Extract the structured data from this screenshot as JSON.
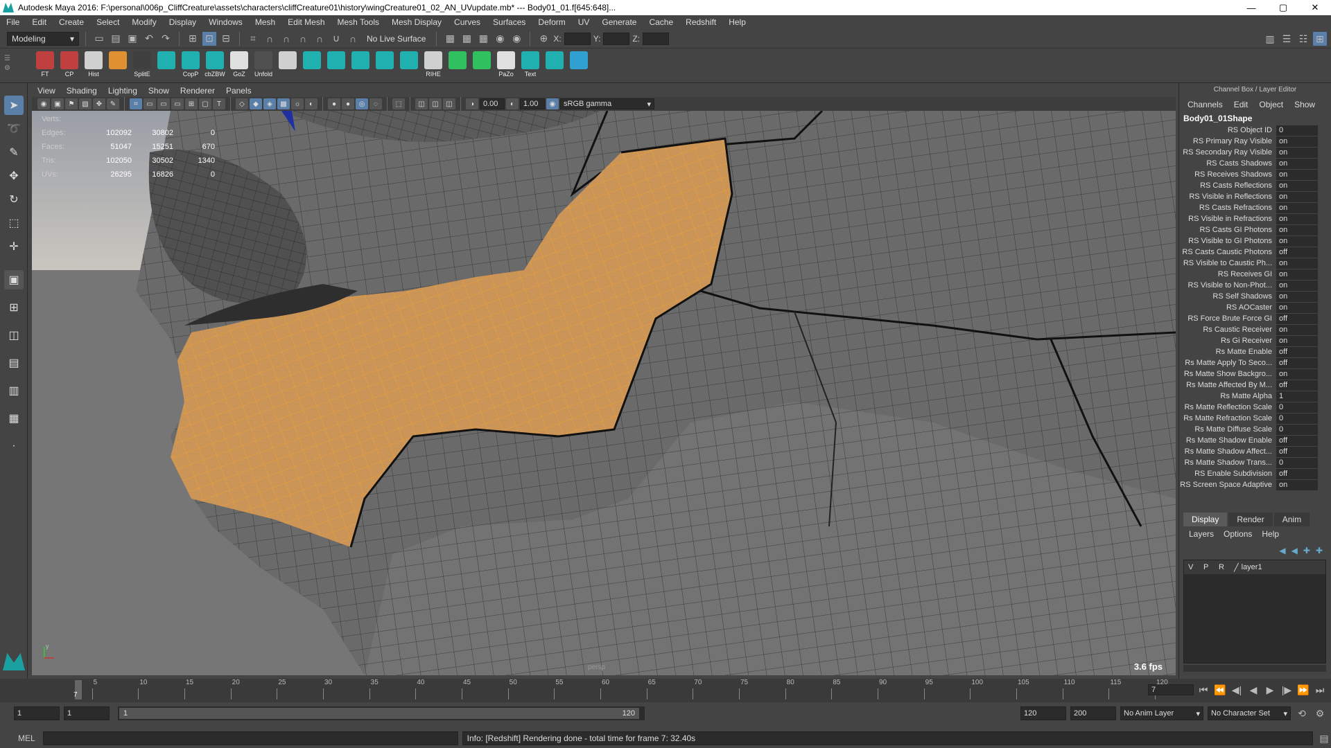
{
  "window": {
    "title": "Autodesk Maya 2016: F:\\personal\\006p_CliffCreature\\assets\\characters\\cliffCreature01\\history\\wingCreature01_02_AN_UVupdate.mb*   ---   Body01_01.f[645:648]...",
    "min": "—",
    "max": "▢",
    "close": "✕"
  },
  "menus": [
    "File",
    "Edit",
    "Create",
    "Select",
    "Modify",
    "Display",
    "Windows",
    "Mesh",
    "Edit Mesh",
    "Mesh Tools",
    "Mesh Display",
    "Curves",
    "Surfaces",
    "Deform",
    "UV",
    "Generate",
    "Cache",
    "Redshift",
    "Help"
  ],
  "statusline": {
    "mode": "Modeling",
    "live_surface": "No Live Surface",
    "x_label": "X:",
    "y_label": "Y:",
    "z_label": "Z:"
  },
  "shelf": [
    {
      "label": "FT",
      "color": "#c04040"
    },
    {
      "label": "CP",
      "color": "#c04040"
    },
    {
      "label": "Hist",
      "color": "#d0d0d0"
    },
    {
      "label": "",
      "color": "#e09030"
    },
    {
      "label": "SplitE",
      "color": "#404040"
    },
    {
      "label": "",
      "color": "#20b0b0"
    },
    {
      "label": "CopP",
      "color": "#20b0b0"
    },
    {
      "label": "cbZBW",
      "color": "#20b0b0"
    },
    {
      "label": "GoZ",
      "color": "#e0e0e0"
    },
    {
      "label": "Unfold",
      "color": "#505050"
    },
    {
      "label": "",
      "color": "#d0d0d0"
    },
    {
      "label": "",
      "color": "#20b0b0"
    },
    {
      "label": "",
      "color": "#20b0b0"
    },
    {
      "label": "",
      "color": "#20b0b0"
    },
    {
      "label": "",
      "color": "#20b0b0"
    },
    {
      "label": "",
      "color": "#20b0b0"
    },
    {
      "label": "RIHE",
      "color": "#d0d0d0"
    },
    {
      "label": "",
      "color": "#30c060"
    },
    {
      "label": "",
      "color": "#30c060"
    },
    {
      "label": "PaZo",
      "color": "#e0e0e0"
    },
    {
      "label": "Text",
      "color": "#20b0b0"
    },
    {
      "label": "",
      "color": "#20b0b0"
    },
    {
      "label": "",
      "color": "#30a0d0"
    }
  ],
  "viewport": {
    "menus": [
      "View",
      "Shading",
      "Lighting",
      "Show",
      "Renderer",
      "Panels"
    ],
    "field1": "0.00",
    "field2": "1.00",
    "colorspace": "sRGB gamma",
    "hud": [
      {
        "label": "Verts:",
        "v1": "",
        "v2": "",
        "v3": ""
      },
      {
        "label": "Edges:",
        "v1": "102092",
        "v2": "30802",
        "v3": "0"
      },
      {
        "label": "Faces:",
        "v1": "51047",
        "v2": "15251",
        "v3": "670"
      },
      {
        "label": "Tris:",
        "v1": "102050",
        "v2": "30502",
        "v3": "1340"
      },
      {
        "label": "UVs:",
        "v1": "26295",
        "v2": "16826",
        "v3": "0"
      }
    ],
    "fps": "3.6 fps",
    "camera": "persp",
    "axis_y": "y",
    "axis_x": "x"
  },
  "channelbox": {
    "header": "Channel Box / Layer Editor",
    "menus": [
      "Channels",
      "Edit",
      "Object",
      "Show"
    ],
    "object": "Body01_01Shape",
    "attrs": [
      {
        "n": "RS Object ID",
        "v": "0"
      },
      {
        "n": "RS Primary Ray Visible",
        "v": "on"
      },
      {
        "n": "RS Secondary Ray Visible",
        "v": "on"
      },
      {
        "n": "RS Casts Shadows",
        "v": "on"
      },
      {
        "n": "RS Receives Shadows",
        "v": "on"
      },
      {
        "n": "RS Casts Reflections",
        "v": "on"
      },
      {
        "n": "RS Visible in Reflections",
        "v": "on"
      },
      {
        "n": "RS Casts Refractions",
        "v": "on"
      },
      {
        "n": "RS Visible in Refractions",
        "v": "on"
      },
      {
        "n": "RS Casts GI Photons",
        "v": "on"
      },
      {
        "n": "RS Visible to GI Photons",
        "v": "on"
      },
      {
        "n": "RS Casts Caustic Photons",
        "v": "off"
      },
      {
        "n": "RS Visible to Caustic Ph...",
        "v": "on"
      },
      {
        "n": "RS Receives GI",
        "v": "on"
      },
      {
        "n": "RS Visible to Non-Phot...",
        "v": "on"
      },
      {
        "n": "RS Self Shadows",
        "v": "on"
      },
      {
        "n": "RS AOCaster",
        "v": "on"
      },
      {
        "n": "RS Force Brute Force GI",
        "v": "off"
      },
      {
        "n": "Rs Caustic Receiver",
        "v": "on"
      },
      {
        "n": "Rs Gi Receiver",
        "v": "on"
      },
      {
        "n": "Rs Matte Enable",
        "v": "off"
      },
      {
        "n": "Rs Matte Apply To Seco...",
        "v": "off"
      },
      {
        "n": "Rs Matte Show Backgro...",
        "v": "on"
      },
      {
        "n": "Rs Matte Affected By M...",
        "v": "off"
      },
      {
        "n": "Rs Matte Alpha",
        "v": "1"
      },
      {
        "n": "Rs Matte Reflection Scale",
        "v": "0"
      },
      {
        "n": "Rs Matte Refraction Scale",
        "v": "0"
      },
      {
        "n": "Rs Matte Diffuse Scale",
        "v": "0"
      },
      {
        "n": "Rs Matte Shadow Enable",
        "v": "off"
      },
      {
        "n": "Rs Matte Shadow Affect...",
        "v": "off"
      },
      {
        "n": "Rs Matte Shadow Trans...",
        "v": "0"
      },
      {
        "n": "RS Enable Subdivision",
        "v": "off"
      },
      {
        "n": "RS Screen Space Adaptive",
        "v": "on"
      }
    ],
    "layer_tabs": [
      "Display",
      "Render",
      "Anim"
    ],
    "layer_menus": [
      "Layers",
      "Options",
      "Help"
    ],
    "layer": {
      "v": "V",
      "p": "P",
      "r": "R",
      "name": "layer1"
    }
  },
  "timeline": {
    "ticks": [
      "5",
      "10",
      "15",
      "20",
      "25",
      "30",
      "35",
      "40",
      "45",
      "50",
      "55",
      "60",
      "65",
      "70",
      "75",
      "80",
      "85",
      "90",
      "95",
      "100",
      "105",
      "110",
      "115",
      "120"
    ],
    "current_frame": "7",
    "current_field": "7"
  },
  "range": {
    "start": "1",
    "start2": "1",
    "slider_start": "1",
    "slider_end": "120",
    "end": "120",
    "end2": "200",
    "anim_layer": "No Anim Layer",
    "char_set": "No Character Set"
  },
  "command": {
    "label": "MEL",
    "info": "Info: [Redshift] Rendering done - total time for frame 7: 32.40s"
  }
}
